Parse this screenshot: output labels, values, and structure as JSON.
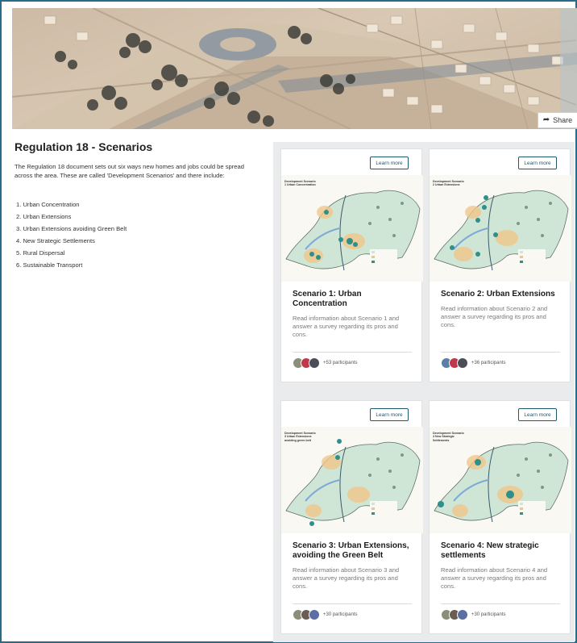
{
  "hero": {
    "share_label": "Share"
  },
  "page": {
    "title": "Regulation 18 - Scenarios",
    "intro": "The Regulation 18 document sets out six ways new homes and jobs could be spread across the area. These are called 'Development Scenarios' and there include:",
    "scenarios": [
      "1. Urban Concentration",
      "2. Urban Extensions",
      "3. Urban Extensions avoiding Green Belt",
      "4. New Strategic Settlements",
      "5. Rural Dispersal",
      "6. Sustainable Transport"
    ]
  },
  "cards": [
    {
      "learn_more": "Learn more",
      "map_heading": "Development Scenario 1 Urban Concentration",
      "title": "Scenario 1: Urban Concentration",
      "description": "Read information about Scenario 1 and answer a survey regarding its pros and cons.",
      "participants": "+53 participants"
    },
    {
      "learn_more": "Learn more",
      "map_heading": "Development Scenario 2 Urban Extensions",
      "title": "Scenario 2: Urban Extensions",
      "description": "Read information about Scenario 2 and answer a survey regarding its pros and cons.",
      "participants": "+36 participants"
    },
    {
      "learn_more": "Learn more",
      "map_heading": "Development Scenario 3 Urban Extensions avoiding green belt",
      "title": "Scenario 3: Urban Extensions, avoiding the Green Belt",
      "description": "Read information about Scenario 3 and answer a survey regarding its pros and cons.",
      "participants": "+30 participants"
    },
    {
      "learn_more": "Learn more",
      "map_heading": "Development Scenario 4 New Strategic Settlements",
      "title": "Scenario 4: New strategic settlements",
      "description": "Read information about Scenario 4 and answer a survey regarding its pros and cons.",
      "participants": "+30 participants"
    }
  ],
  "colors": {
    "frame_border": "#2a6b8a",
    "button_outline": "#1e5a6e",
    "panel_background": "#e9ebed",
    "map_green": "#cfe6d6",
    "map_growth": "#f0c58a",
    "map_marker": "#2f8f8a"
  }
}
